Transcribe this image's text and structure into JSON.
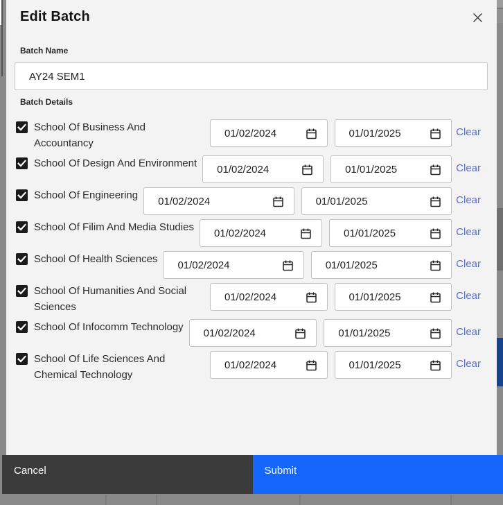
{
  "modal": {
    "title": "Edit Batch",
    "batch_name": {
      "label": "Batch Name",
      "value": "AY24 SEM1"
    },
    "details_label": "Batch Details",
    "clear_label": "Clear",
    "rows": [
      {
        "school": "School Of Business And Accountancy",
        "checked": true,
        "start_date": "01/02/2024",
        "end_date": "01/01/2025"
      },
      {
        "school": "School Of Design And Environment",
        "checked": true,
        "start_date": "01/02/2024",
        "end_date": "01/01/2025"
      },
      {
        "school": "School Of Engineering",
        "checked": true,
        "start_date": "01/02/2024",
        "end_date": "01/01/2025"
      },
      {
        "school": "School Of Filim And Media Studies",
        "checked": true,
        "start_date": "01/02/2024",
        "end_date": "01/01/2025"
      },
      {
        "school": "School Of Health Sciences",
        "checked": true,
        "start_date": "01/02/2024",
        "end_date": "01/01/2025"
      },
      {
        "school": "School Of Humanities And Social Sciences",
        "checked": true,
        "start_date": "01/02/2024",
        "end_date": "01/01/2025"
      },
      {
        "school": "School Of Infocomm Technology",
        "checked": true,
        "start_date": "01/02/2024",
        "end_date": "01/01/2025"
      },
      {
        "school": "School Of Life Sciences And Chemical Technology",
        "checked": true,
        "start_date": "01/02/2024",
        "end_date": "01/01/2025"
      }
    ],
    "footer": {
      "cancel_label": "Cancel",
      "submit_label": "Submit"
    }
  },
  "icons": {
    "close": "close-icon",
    "calendar": "calendar-icon",
    "checkbox_check": "check-icon"
  },
  "colors": {
    "modal_bg": "#f2f3f2",
    "submit_blue": "#1567fb",
    "cancel_dark": "#3b3b3b",
    "clear_link": "#5e6cc0",
    "checkbox_black": "#1b1b1b",
    "backdrop_gray": "#8a8a8a",
    "backdrop_blue_segment": "#17428c"
  }
}
